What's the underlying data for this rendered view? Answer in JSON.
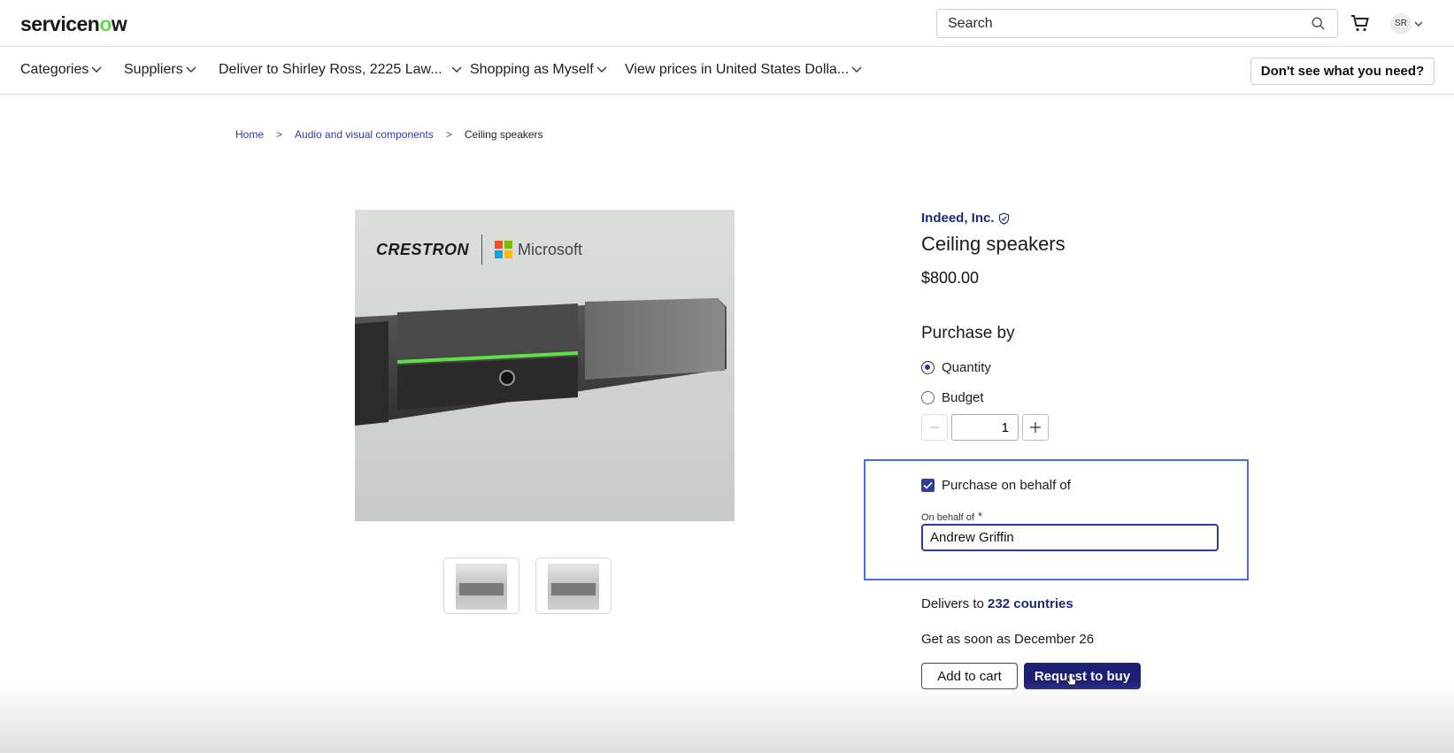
{
  "header": {
    "logo_text": "servicenow",
    "search_placeholder": "Search",
    "avatar_initials": "SR"
  },
  "nav": {
    "items": [
      {
        "label": "Categories"
      },
      {
        "label": "Suppliers"
      },
      {
        "label": "Deliver to Shirley Ross, 2225 Law..."
      },
      {
        "label": "Shopping as Myself"
      },
      {
        "label": "View prices in United States Dolla..."
      }
    ],
    "help_button": "Don't see what you need?"
  },
  "breadcrumb": {
    "items": [
      "Home",
      "Audio and visual components"
    ],
    "current": "Ceiling speakers"
  },
  "image": {
    "brand_left": "CRESTRON",
    "brand_right": "Microsoft",
    "ms_colors": [
      "#f25022",
      "#7fba00",
      "#00a4ef",
      "#ffb900"
    ]
  },
  "product": {
    "supplier": "Indeed, Inc.",
    "title": "Ceiling speakers",
    "price": "$800.00",
    "purchase_by_label": "Purchase by",
    "options": [
      "Quantity",
      "Budget"
    ],
    "selected_option": "Quantity",
    "quantity": "1"
  },
  "behalf": {
    "checkbox_label": "Purchase on behalf of",
    "checked": true,
    "field_label": "On behalf of",
    "required_mark": "*",
    "value": "Andrew Griffin"
  },
  "delivery": {
    "delivers_prefix": "Delivers to",
    "countries_link": "232 countries",
    "eta": "Get as soon as December 26"
  },
  "actions": {
    "add_to_cart": "Add to cart",
    "request_to_buy": "Request to buy"
  },
  "colors": {
    "accent": "#1c1f73",
    "link": "#2f3aa8",
    "highlight_border": "#4a6ee0",
    "brand_green": "#62d84e"
  }
}
